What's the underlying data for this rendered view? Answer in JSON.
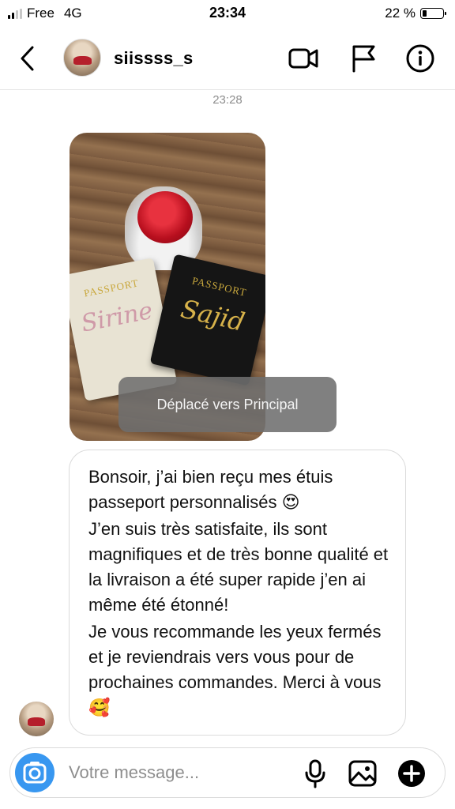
{
  "status_bar": {
    "carrier": "Free",
    "network": "4G",
    "time": "23:34",
    "battery_percent": "22 %",
    "battery_level": 0.22
  },
  "header": {
    "username": "siissss_s",
    "back_icon": "chevron-left-icon",
    "video_icon": "video-camera-icon",
    "flag_icon": "flag-icon",
    "info_icon": "info-icon"
  },
  "thread": {
    "timestamp": "23:28",
    "photo": {
      "passport_left": {
        "title": "PASSPORT",
        "name": "Sirine"
      },
      "passport_right": {
        "title": "PASSPORT",
        "name": "Sajid"
      }
    },
    "toast": "Déplacé vers Principal",
    "message": {
      "paragraphs": [
        "Bonsoir, j’ai bien reçu mes étuis passeport personnalisés 😍",
        "J’en suis très satisfaite, ils sont magnifiques et de très bonne qualité et la livraison a été super rapide j’en ai même été étonné!",
        "Je vous recommande les yeux fermés et je reviendrais vers vous pour de prochaines commandes. Merci à vous 🥰"
      ]
    }
  },
  "composer": {
    "placeholder": "Votre message...",
    "camera_icon": "camera-icon",
    "mic_icon": "microphone-icon",
    "gallery_icon": "gallery-icon",
    "plus_icon": "plus-circle-icon"
  },
  "colors": {
    "accent": "#3897f0",
    "border": "#dbdbdb",
    "muted_text": "#8e8e8e"
  }
}
